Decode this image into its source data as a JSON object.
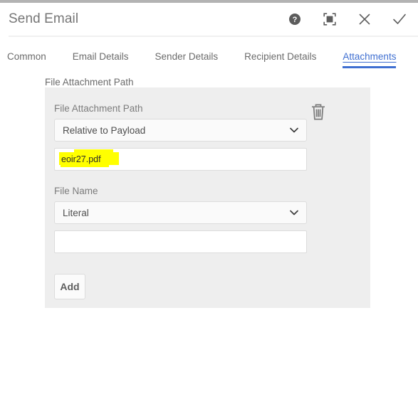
{
  "window": {
    "title": "Send Email",
    "actions": [
      {
        "name": "help-icon",
        "label": "Help"
      },
      {
        "name": "maximize-icon",
        "label": "Maximize"
      },
      {
        "name": "close-icon",
        "label": "Close"
      },
      {
        "name": "confirm-check-icon",
        "label": "Confirm"
      }
    ]
  },
  "tabs": [
    {
      "label": "Common",
      "active": false
    },
    {
      "label": "Email Details",
      "active": false
    },
    {
      "label": "Sender Details",
      "active": false
    },
    {
      "label": "Recipient Details",
      "active": false
    },
    {
      "label": "Attachments",
      "active": true
    }
  ],
  "form": {
    "section_label": "File Attachment Path",
    "attachment_path": {
      "label": "File Attachment Path",
      "mode_selected": "Relative to Payload",
      "value": "eoir27.pdf",
      "placeholder": ""
    },
    "file_name": {
      "label": "File Name",
      "mode_selected": "Literal",
      "value": "",
      "placeholder": ""
    },
    "add_label": "Add",
    "delete_icon": "trash-icon"
  },
  "colors": {
    "accent": "#3f6fd1",
    "panel": "#eeeeee",
    "highlight": "#ffff00",
    "text_muted": "#6b6b6b"
  }
}
